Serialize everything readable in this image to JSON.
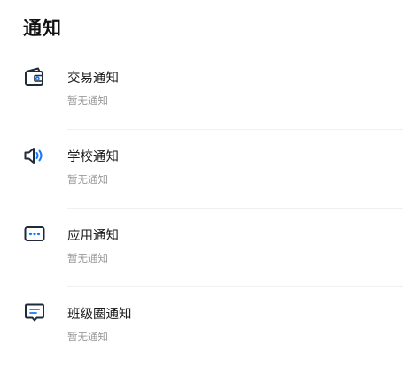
{
  "header": {
    "title": "通知"
  },
  "items": [
    {
      "title": "交易通知",
      "subtitle": "暂无通知",
      "icon": "wallet-icon"
    },
    {
      "title": "学校通知",
      "subtitle": "暂无通知",
      "icon": "speaker-icon"
    },
    {
      "title": "应用通知",
      "subtitle": "暂无通知",
      "icon": "more-dots-icon"
    },
    {
      "title": "班级圈通知",
      "subtitle": "暂无通知",
      "icon": "message-icon"
    }
  ],
  "colors": {
    "icon_dark": "#1f2a3a",
    "icon_accent": "#1677ff",
    "subtitle": "#9a9a9a"
  }
}
